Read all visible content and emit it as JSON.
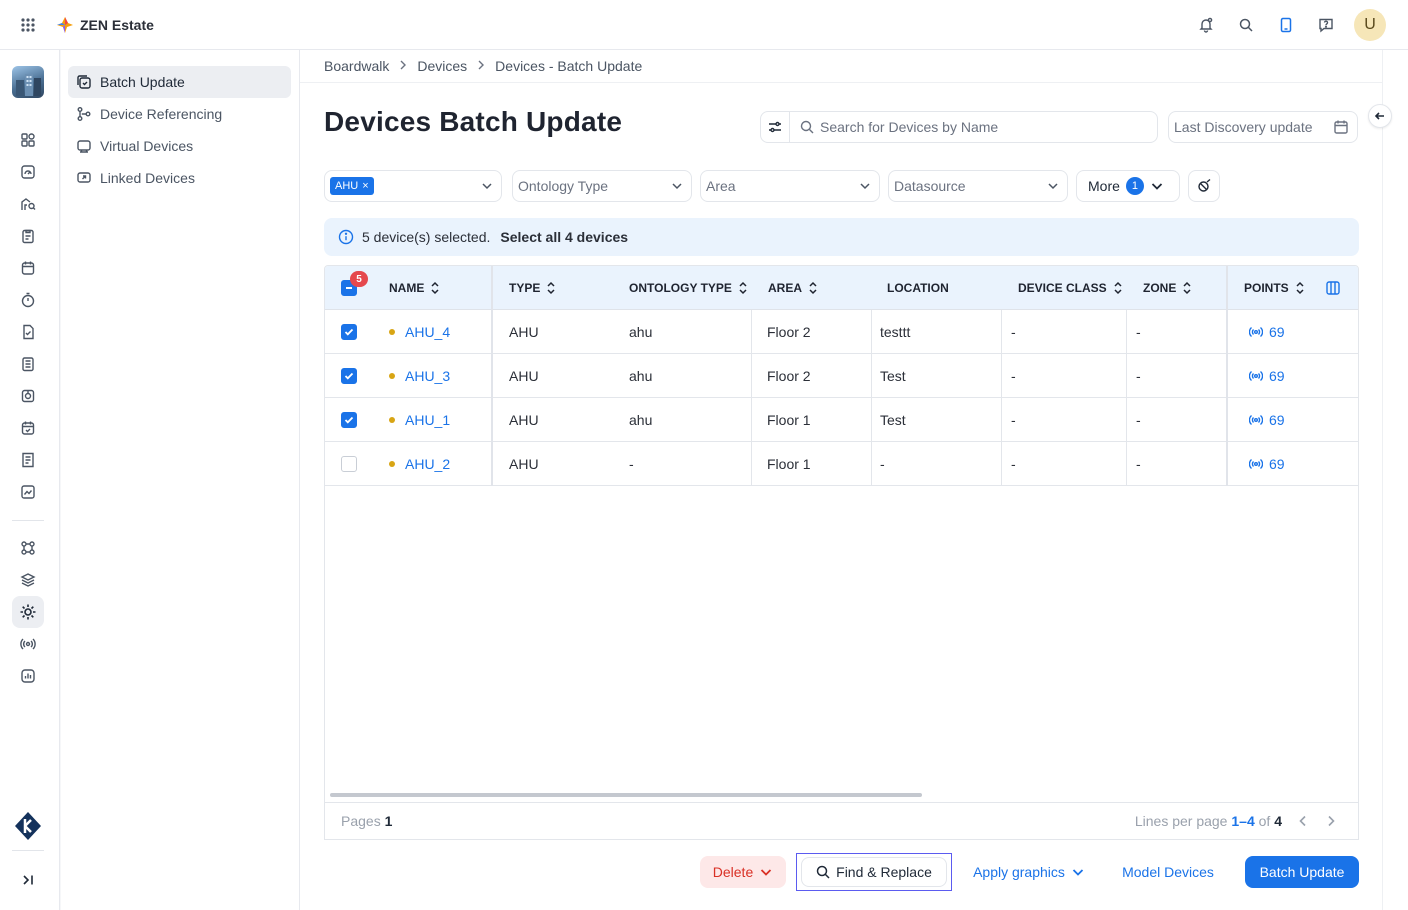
{
  "app": {
    "name": "ZEN Estate"
  },
  "sidebar": {
    "items": [
      {
        "label": "Batch Update",
        "active": true
      },
      {
        "label": "Device Referencing",
        "active": false
      },
      {
        "label": "Virtual Devices",
        "active": false
      },
      {
        "label": "Linked Devices",
        "active": false
      }
    ]
  },
  "breadcrumb": [
    "Boardwalk",
    "Devices",
    "Devices - Batch Update"
  ],
  "page": {
    "title": "Devices Batch Update",
    "search_placeholder": "Search for Devices by Name",
    "date_placeholder": "Last Discovery update"
  },
  "filters": {
    "type_chip": "AHU",
    "ontology_placeholder": "Ontology Type",
    "area_placeholder": "Area",
    "datasource_placeholder": "Datasource",
    "more_label": "More",
    "more_count": "1"
  },
  "selection": {
    "message": "5 device(s) selected.",
    "select_all": "Select all 4 devices",
    "header_badge": "5"
  },
  "table": {
    "columns": [
      "NAME",
      "TYPE",
      "ONTOLOGY TYPE",
      "AREA",
      "LOCATION",
      "DEVICE CLASS",
      "ZONE",
      "POINTS"
    ],
    "rows": [
      {
        "checked": true,
        "name": "AHU_4",
        "type": "AHU",
        "ontology": "ahu",
        "area": "Floor 2",
        "location": "testtt",
        "device_class": "-",
        "zone": "-",
        "points": "69"
      },
      {
        "checked": true,
        "name": "AHU_3",
        "type": "AHU",
        "ontology": "ahu",
        "area": "Floor 2",
        "location": "Test",
        "device_class": "-",
        "zone": "-",
        "points": "69"
      },
      {
        "checked": true,
        "name": "AHU_1",
        "type": "AHU",
        "ontology": "ahu",
        "area": "Floor 1",
        "location": "Test",
        "device_class": "-",
        "zone": "-",
        "points": "69"
      },
      {
        "checked": false,
        "name": "AHU_2",
        "type": "AHU",
        "ontology": "-",
        "area": "Floor 1",
        "location": "-",
        "device_class": "-",
        "zone": "-",
        "points": "69"
      }
    ]
  },
  "pager": {
    "pages_label": "Pages",
    "pages_value": "1",
    "lines_label": "Lines per page",
    "range": "1–4",
    "of_label": "of",
    "total": "4"
  },
  "actions": {
    "delete": "Delete",
    "find_replace": "Find & Replace",
    "apply_graphics": "Apply graphics",
    "model_devices": "Model Devices",
    "batch_update": "Batch Update"
  },
  "user": {
    "initial": "U"
  },
  "colors": {
    "accent": "#1a73e8",
    "danger": "#d93025",
    "status_dot": "#d8a514"
  }
}
